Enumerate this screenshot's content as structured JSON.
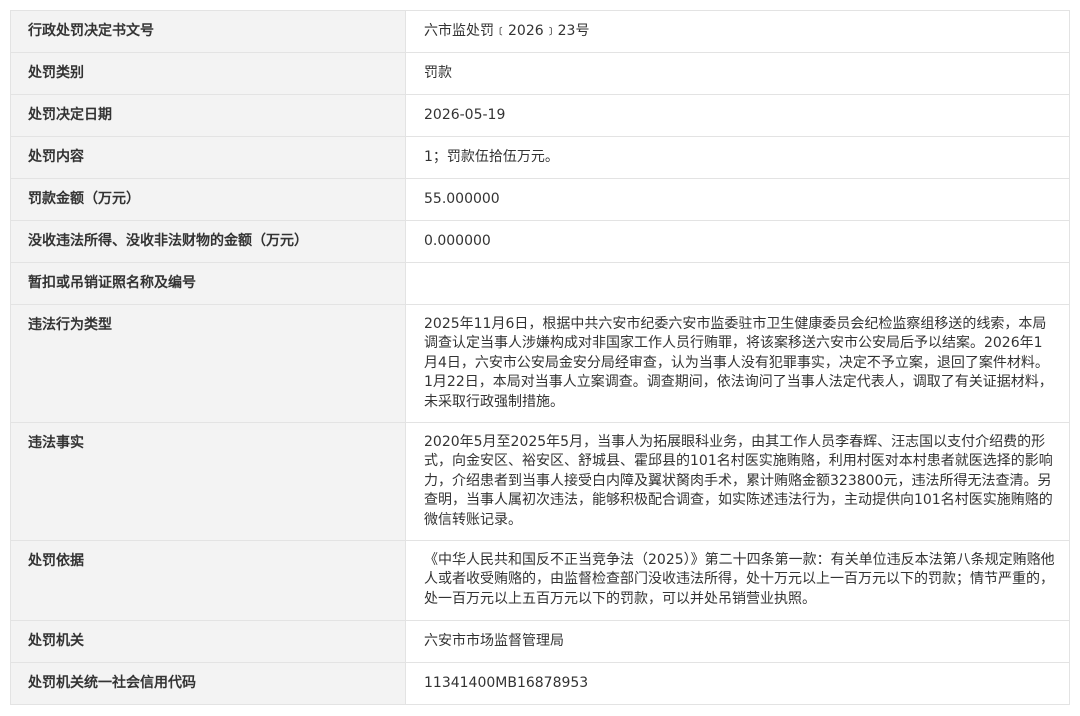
{
  "rows": [
    {
      "label": "行政处罚决定书文号",
      "value": "六市监处罚﹝2026﹞23号"
    },
    {
      "label": "处罚类别",
      "value": "罚款"
    },
    {
      "label": "处罚决定日期",
      "value": "2026-05-19"
    },
    {
      "label": "处罚内容",
      "value": "1；罚款伍拾伍万元。"
    },
    {
      "label": "罚款金额（万元）",
      "value": "55.000000"
    },
    {
      "label": "没收违法所得、没收非法财物的金额（万元）",
      "value": "0.000000"
    },
    {
      "label": "暂扣或吊销证照名称及编号",
      "value": ""
    },
    {
      "label": "违法行为类型",
      "value": "2025年11月6日，根据中共六安市纪委六安市监委驻市卫生健康委员会纪检监察组移送的线索，本局调查认定当事人涉嫌构成对非国家工作人员行贿罪，将该案移送六安市公安局后予以结案。2026年1月4日，六安市公安局金安分局经审查，认为当事人没有犯罪事实，决定不予立案，退回了案件材料。1月22日，本局对当事人立案调查。调查期间，依法询问了当事人法定代表人，调取了有关证据材料，未采取行政强制措施。"
    },
    {
      "label": "违法事实",
      "value": "2020年5月至2025年5月，当事人为拓展眼科业务，由其工作人员李春辉、汪志国以支付介绍费的形式，向金安区、裕安区、舒城县、霍邱县的101名村医实施贿赂，利用村医对本村患者就医选择的影响力，介绍患者到当事人接受白内障及翼状胬肉手术，累计贿赂金额323800元，违法所得无法查清。另查明，当事人属初次违法，能够积极配合调查，如实陈述违法行为，主动提供向101名村医实施贿赂的微信转账记录。"
    },
    {
      "label": "处罚依据",
      "value": "《中华人民共和国反不正当竞争法（2025）》第二十四条第一款：有关单位违反本法第八条规定贿赂他人或者收受贿赂的，由监督检查部门没收违法所得，处十万元以上一百万元以下的罚款；情节严重的，处一百万元以上五百万元以下的罚款，可以并处吊销营业执照。"
    },
    {
      "label": "处罚机关",
      "value": "六安市市场监督管理局"
    },
    {
      "label": "处罚机关统一社会信用代码",
      "value": "11341400MB16878953"
    }
  ]
}
